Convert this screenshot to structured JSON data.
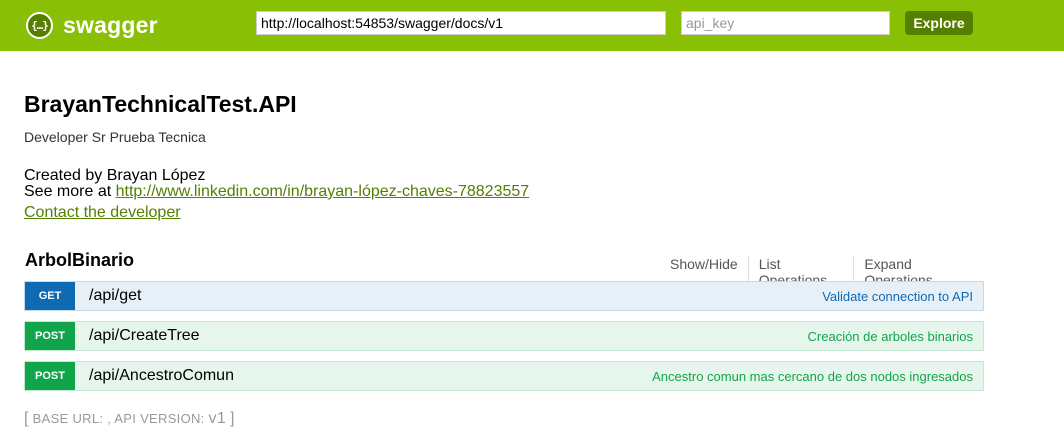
{
  "header": {
    "logo_symbol": "{…}",
    "logo_text": "swagger",
    "url_value": "http://localhost:54853/swagger/docs/v1",
    "api_key_placeholder": "api_key",
    "explore_label": "Explore",
    "colors": {
      "bar": "#89bf04",
      "button": "#547f00"
    }
  },
  "info": {
    "title": "BrayanTechnicalTest.API",
    "description": "Developer Sr Prueba Tecnica",
    "created_by": "Created by Brayan López",
    "see_more_prefix": "See more at ",
    "see_more_link": "http://www.linkedin.com/in/brayan-lópez-chaves-78823557",
    "contact_label": "Contact the developer"
  },
  "resource": {
    "name": "ArbolBinario",
    "actions": [
      "Show/Hide",
      "List Operations",
      "Expand Operations"
    ],
    "operations": [
      {
        "method": "GET",
        "path": "/api/get",
        "summary": "Validate connection to API"
      },
      {
        "method": "POST",
        "path": "/api/CreateTree",
        "summary": "Creación de arboles binarios"
      },
      {
        "method": "POST",
        "path": "/api/AncestroComun",
        "summary": "Ancestro comun mas cercano de dos nodos ingresados"
      }
    ]
  },
  "footer": {
    "open_bracket": "[",
    "base_url_label": "BASE URL: , API VERSION: ",
    "version": "v1",
    "close_bracket": "]"
  }
}
